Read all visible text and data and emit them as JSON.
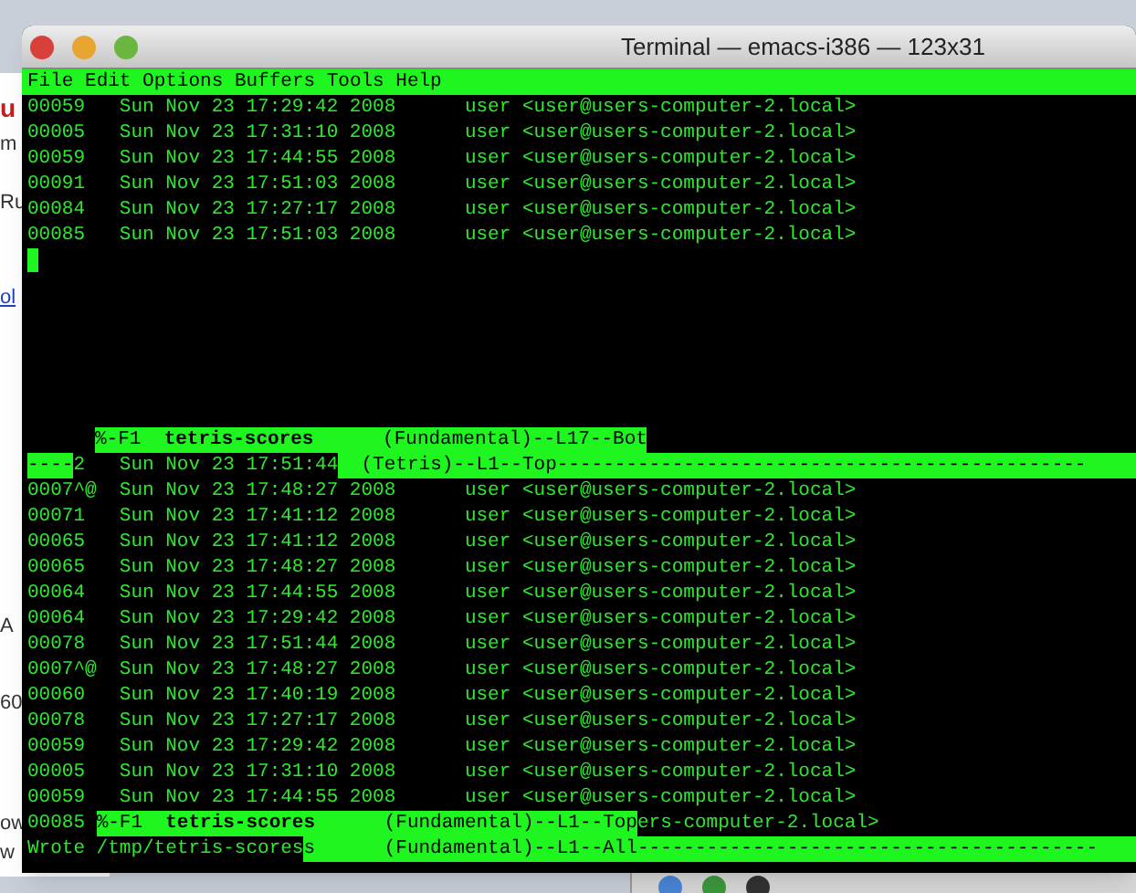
{
  "background_window": {
    "texts": [
      {
        "text": "u",
        "kind": "heading"
      },
      {
        "text": "m",
        "kind": "small"
      },
      {
        "text": "Ru",
        "kind": "small"
      },
      {
        "text": "ol",
        "kind": "link"
      },
      {
        "text": "A",
        "kind": "small"
      },
      {
        "text": "60",
        "kind": "small"
      },
      {
        "text": "ow",
        "kind": "small"
      },
      {
        "text": "w",
        "kind": "small"
      }
    ]
  },
  "window": {
    "title": "Terminal — emacs-i386 — 123x31"
  },
  "menu_bar": [
    "File",
    "Edit",
    "Options",
    "Buffers",
    "Tools",
    "Help"
  ],
  "top_pane": {
    "lines": [
      "00059   Sun Nov 23 17:29:42 2008      user <user@users-computer-2.local>",
      "00005   Sun Nov 23 17:31:10 2008      user <user@users-computer-2.local>",
      "00059   Sun Nov 23 17:44:55 2008      user <user@users-computer-2.local>",
      "00091   Sun Nov 23 17:51:03 2008      user <user@users-computer-2.local>",
      "00084   Sun Nov 23 17:27:17 2008      user <user@users-computer-2.local>",
      "00085   Sun Nov 23 17:51:03 2008      user <user@users-computer-2.local>"
    ],
    "cursor": true
  },
  "screen_lines": [
    {
      "kind": "shifted",
      "segments": [
        {
          "text": "%-F1  **tetris-scores**      (Fundamental)--L17--Bot",
          "inverse": true
        }
      ]
    },
    {
      "kind": "plain",
      "segments": [
        {
          "text": "----",
          "inverse": true
        },
        {
          "text": "2   Sun Nov 23 17:51:44",
          "inverse": false
        },
        {
          "text": "  (Tetris)--L1--Top----------------------------------------------",
          "inverse": true
        }
      ]
    },
    {
      "kind": "plain",
      "segments": [
        {
          "text": "0007^@  Sun Nov 23 17:48:27 2008      user <user@users-computer-2.local>",
          "inverse": false
        }
      ]
    },
    {
      "kind": "plain",
      "segments": [
        {
          "text": "00071   Sun Nov 23 17:41:12 2008      user <user@users-computer-2.local>",
          "inverse": false
        }
      ]
    },
    {
      "kind": "plain",
      "segments": [
        {
          "text": "00065   Sun Nov 23 17:41:12 2008      user <user@users-computer-2.local>",
          "inverse": false
        }
      ]
    },
    {
      "kind": "plain",
      "segments": [
        {
          "text": "00065   Sun Nov 23 17:48:27 2008      user <user@users-computer-2.local>",
          "inverse": false
        }
      ]
    },
    {
      "kind": "plain",
      "segments": [
        {
          "text": "00064   Sun Nov 23 17:44:55 2008      user <user@users-computer-2.local>",
          "inverse": false
        }
      ]
    },
    {
      "kind": "plain",
      "segments": [
        {
          "text": "00064   Sun Nov 23 17:29:42 2008      user <user@users-computer-2.local>",
          "inverse": false
        }
      ]
    },
    {
      "kind": "plain",
      "segments": [
        {
          "text": "00078   Sun Nov 23 17:51:44 2008      user <user@users-computer-2.local>",
          "inverse": false
        }
      ]
    },
    {
      "kind": "plain",
      "segments": [
        {
          "text": "0007^@  Sun Nov 23 17:48:27 2008      user <user@users-computer-2.local>",
          "inverse": false
        }
      ]
    },
    {
      "kind": "plain",
      "segments": [
        {
          "text": "00060   Sun Nov 23 17:40:19 2008      user <user@users-computer-2.local>",
          "inverse": false
        }
      ]
    },
    {
      "kind": "plain",
      "segments": [
        {
          "text": "00078   Sun Nov 23 17:27:17 2008      user <user@users-computer-2.local>",
          "inverse": false
        }
      ]
    },
    {
      "kind": "plain",
      "segments": [
        {
          "text": "00059   Sun Nov 23 17:29:42 2008      user <user@users-computer-2.local>",
          "inverse": false
        }
      ]
    },
    {
      "kind": "plain",
      "segments": [
        {
          "text": "00005   Sun Nov 23 17:31:10 2008      user <user@users-computer-2.local>",
          "inverse": false
        }
      ]
    },
    {
      "kind": "plain",
      "segments": [
        {
          "text": "00059   Sun Nov 23 17:44:55 2008      user <user@users-computer-2.local>",
          "inverse": false
        }
      ]
    },
    {
      "kind": "plain",
      "segments": [
        {
          "text": "00085 ",
          "inverse": false
        },
        {
          "text": "%-F1  **tetris-scores**      (Fundamental)--L1--Top",
          "inverse": true
        },
        {
          "text": "ers-computer-2.local>",
          "inverse": false
        }
      ]
    },
    {
      "kind": "plain",
      "segments": [
        {
          "text": "Wrote /tmp/tetris-scores",
          "inverse": false
        },
        {
          "text": "s      (Fundamental)--L1--All----------------------------------------",
          "inverse": true
        }
      ]
    }
  ]
}
